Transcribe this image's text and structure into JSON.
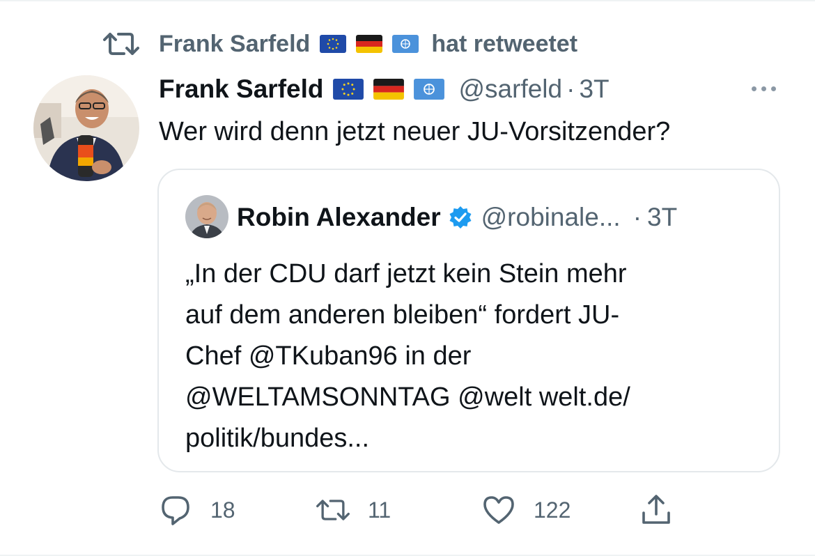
{
  "retweet_context": {
    "name": "Frank Sarfeld",
    "suffix": "hat retweetet",
    "flags": [
      "eu-flag",
      "germany-flag",
      "un-flag"
    ]
  },
  "tweet": {
    "author_name": "Frank Sarfeld",
    "flags": [
      "eu-flag",
      "germany-flag",
      "un-flag"
    ],
    "handle": "@sarfeld",
    "dot": "·",
    "time": "3T",
    "text": "Wer wird denn jetzt neuer JU-Vorsitzender?"
  },
  "quote": {
    "author_name": "Robin Alexander",
    "verified": true,
    "handle": "@robinale...",
    "dot": "·",
    "time": "3T",
    "text": "„In der CDU darf jetzt kein Stein mehr\nauf dem anderen bleiben“ fordert JU-\nChef @TKuban96 in der\n@WELTAMSONNTAG @welt  welt.de/\npolitik/bundes..."
  },
  "actions": {
    "reply_count": "18",
    "retweet_count": "11",
    "like_count": "122"
  },
  "colors": {
    "text_primary": "#0f1419",
    "text_secondary": "#536471",
    "border": "#e4e8eb",
    "verified_blue": "#1d9bf0"
  }
}
